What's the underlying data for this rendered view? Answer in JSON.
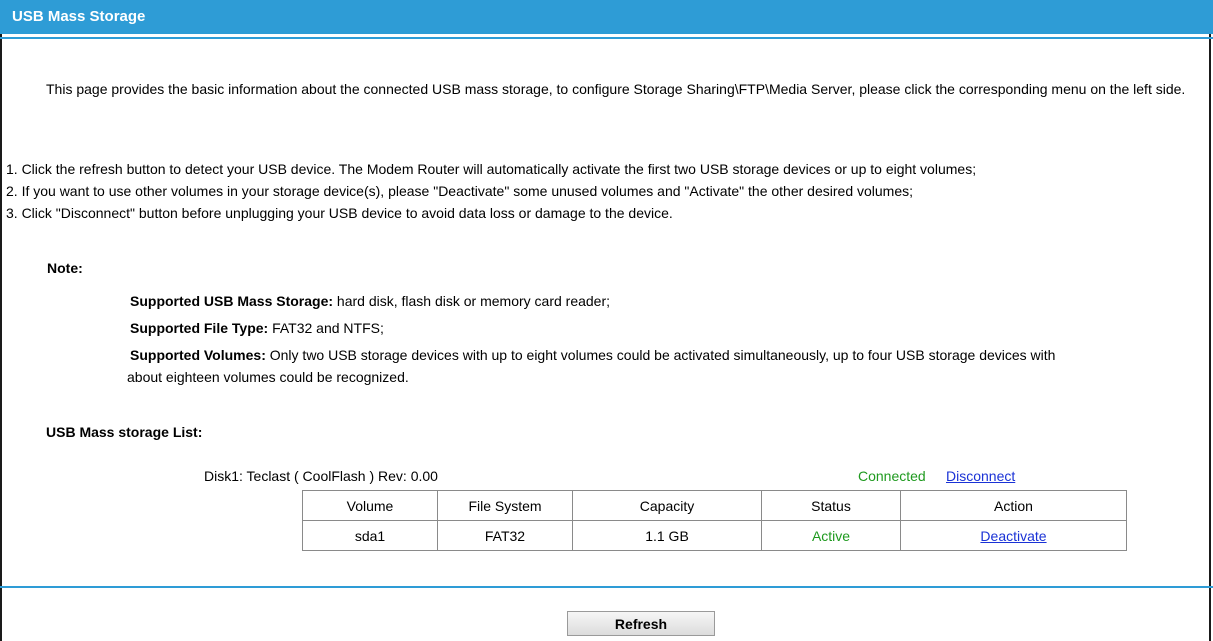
{
  "header": {
    "title": "USB Mass Storage"
  },
  "intro": "This page provides the basic information about the connected USB mass storage, to configure Storage Sharing\\FTP\\Media Server, please click the corresponding menu on the left side.",
  "steps": [
    "1.  Click the refresh button to detect your USB device. The Modem Router will automatically activate the first two USB storage devices or up to eight volumes;",
    "2.  If you want to use other volumes in your storage device(s), please \"Deactivate\" some unused volumes and \"Activate\" the other desired volumes;",
    "3.  Click \"Disconnect\" button before unplugging your USB device to avoid data loss or damage to the device."
  ],
  "note": {
    "label": "Note:",
    "items": [
      {
        "term": "Supported USB Mass Storage:",
        "text": " hard disk, flash disk or memory card reader;"
      },
      {
        "term": "Supported File Type:",
        "text": " FAT32 and NTFS;"
      },
      {
        "term": "Supported Volumes:",
        "text": " Only two USB storage devices with up to eight volumes could be activated simultaneously, up to four USB storage devices with",
        "cont": "about eighteen volumes could be recognized."
      }
    ]
  },
  "list": {
    "label": "USB Mass storage List:",
    "disk": {
      "info": "Disk1: Teclast ( CoolFlash ) Rev: 0.00",
      "status": "Connected",
      "disconnect_label": "Disconnect"
    },
    "columns": [
      "Volume",
      "File System",
      "Capacity",
      "Status",
      "Action"
    ],
    "rows": [
      {
        "volume": "sda1",
        "fs": "FAT32",
        "capacity": "1.1 GB",
        "status": "Active",
        "action": "Deactivate"
      }
    ]
  },
  "buttons": {
    "refresh": "Refresh"
  },
  "colors": {
    "accent": "#2e9cd6",
    "active": "#1f9a1f",
    "link": "#1a32d6"
  }
}
